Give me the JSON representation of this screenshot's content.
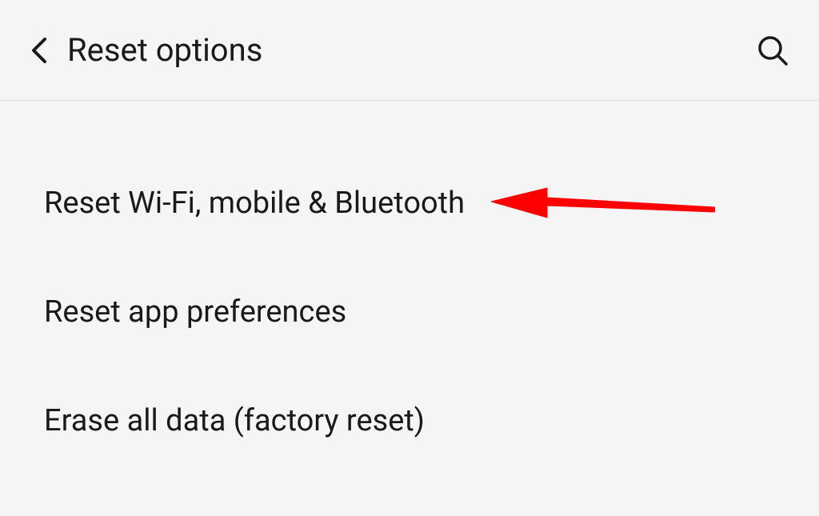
{
  "header": {
    "title": "Reset options"
  },
  "options": [
    {
      "label": "Reset Wi-Fi, mobile & Bluetooth",
      "highlighted": true
    },
    {
      "label": "Reset app preferences",
      "highlighted": false
    },
    {
      "label": "Erase all data (factory reset)",
      "highlighted": false
    }
  ],
  "annotation": {
    "color": "#ff0000"
  }
}
